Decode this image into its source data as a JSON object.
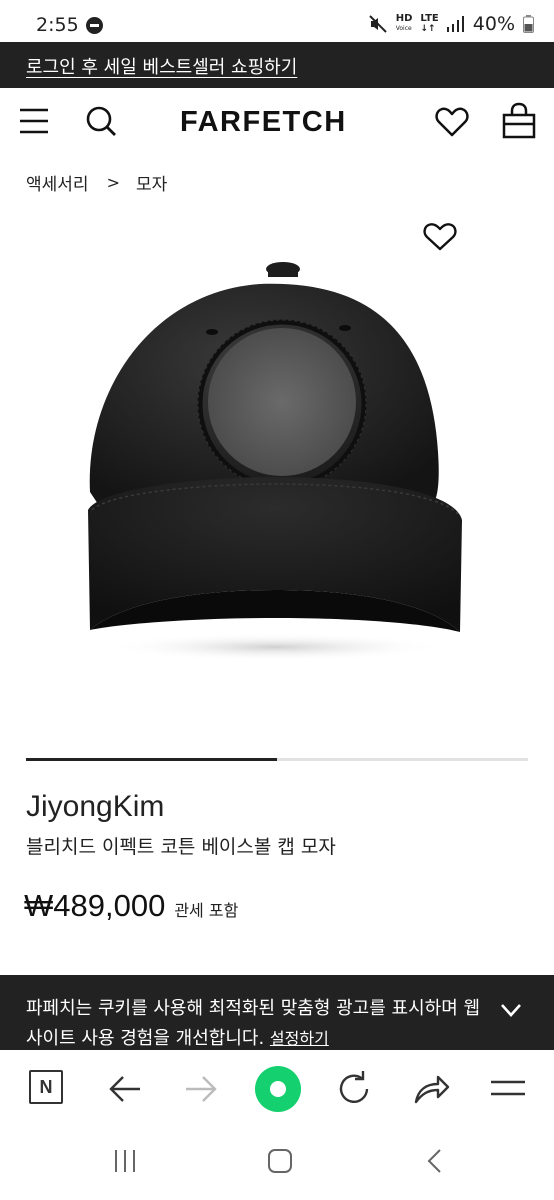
{
  "status_bar": {
    "time": "2:55",
    "network_top": "HD",
    "network_sub": "Voice",
    "lte_label": "LTE",
    "battery": "40%"
  },
  "promo_banner": {
    "text": "로그인 후 세일 베스트셀러 쇼핑하기"
  },
  "header": {
    "logo": "FARFETCH",
    "icons": [
      "menu-icon",
      "search-icon",
      "heart-icon",
      "bag-icon"
    ]
  },
  "breadcrumb": {
    "items": [
      "액세서리",
      "모자"
    ],
    "separator": ">"
  },
  "product": {
    "brand": "JiyongKim",
    "name": "블리치드 이펙트 코튼 베이스볼 캡 모자",
    "price": "₩489,000",
    "tax_note": "관세 포함",
    "image_progress": 0.5
  },
  "cookie_banner": {
    "text": "파페치는 쿠키를 사용해 최적화된 맞춤형 광고를 표시하며 웹사이트 사용 경험을 개선합니다.",
    "link": "설정하기"
  },
  "browser_bar": {
    "n_label": "N",
    "icons": [
      "n-home-icon",
      "back-arrow-icon",
      "forward-arrow-icon",
      "green-home-icon",
      "refresh-icon",
      "share-icon",
      "menu-lines-icon"
    ]
  },
  "colors": {
    "banner_bg": "#222222",
    "accent_green": "#14d06e",
    "text": "#222222"
  }
}
